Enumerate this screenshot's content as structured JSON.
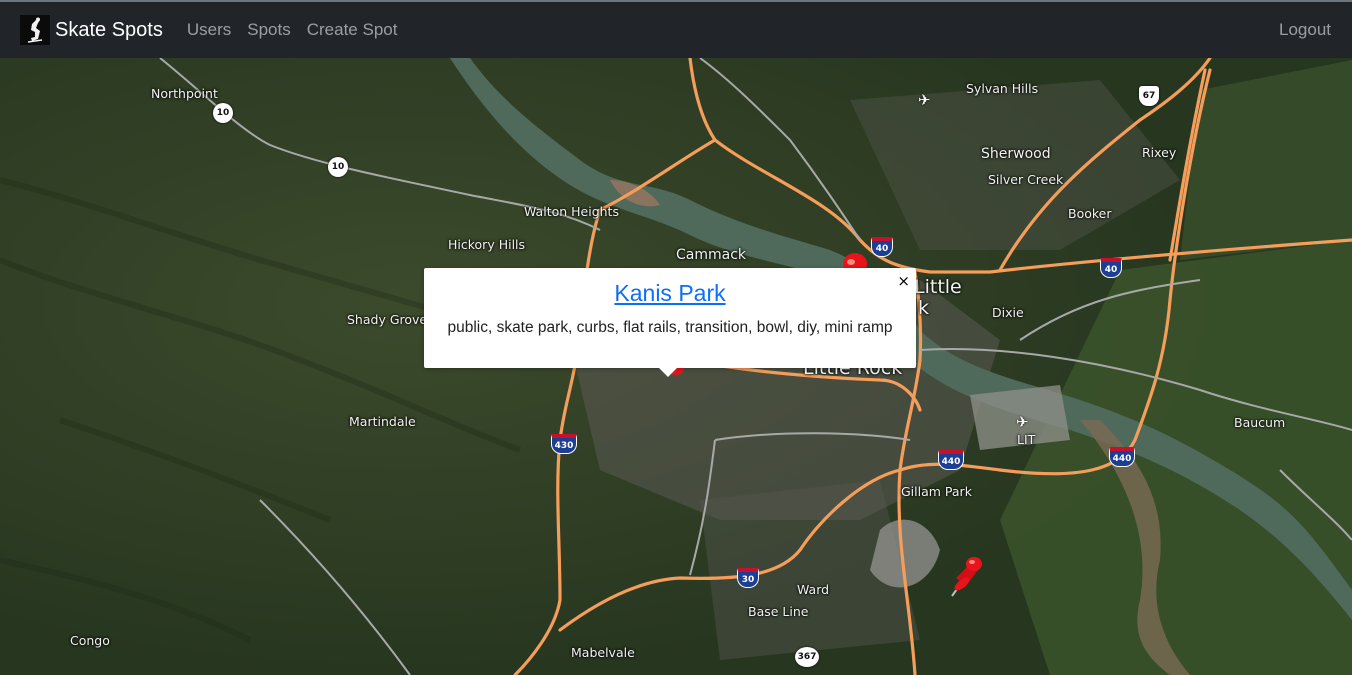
{
  "navbar": {
    "brand": "Skate Spots",
    "links": [
      "Users",
      "Spots",
      "Create Spot"
    ],
    "logout": "Logout"
  },
  "map": {
    "places": {
      "northpoint": "Northpoint",
      "sylvan_hills": "Sylvan Hills",
      "sherwood": "Sherwood",
      "rixey": "Rixey",
      "silver_creek": "Silver Creek",
      "booker": "Booker",
      "walton_heights": "Walton Heights",
      "hickory_hills": "Hickory Hills",
      "cammack": "Cammack",
      "little_rock_n": "Little",
      "little_rock_n2": "k",
      "little_rock": "Little Rock",
      "dixie": "Dixie",
      "shady_grove": "Shady Grove",
      "martindale": "Martindale",
      "lit": "LIT",
      "baucum": "Baucum",
      "gillam_park": "Gillam Park",
      "ward": "Ward",
      "base_line": "Base Line",
      "congo": "Congo",
      "mabelvale": "Mabelvale"
    },
    "shields": {
      "hwy10_a": "10",
      "hwy10_b": "10",
      "i40_a": "40",
      "i40_b": "40",
      "us67": "67",
      "i430": "430",
      "i440_a": "440",
      "i440_b": "440",
      "i30": "30",
      "hwy367": "367"
    },
    "pin_color": "#e8141c"
  },
  "popup": {
    "title": "Kanis Park",
    "description": "public, skate park, curbs, flat rails, transition, bowl, diy, mini ramp",
    "close": "×"
  }
}
